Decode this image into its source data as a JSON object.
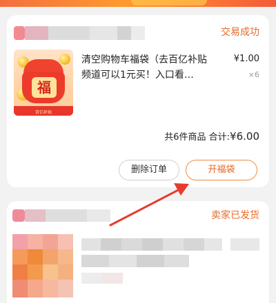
{
  "order1": {
    "status": "交易成功",
    "product_title": "清空购物车福袋（去百亿补贴频道可以1元买！入口看…",
    "product_image_text": "福",
    "product_image_caption": "百亿补贴",
    "price": "¥1.00",
    "quantity": "×6",
    "summary_prefix": "共6件商品 合计:",
    "summary_total": "¥6.00",
    "delete_button": "删除订单",
    "open_button": "开福袋"
  },
  "order2": {
    "status": "卖家已发货"
  },
  "colors": {
    "accent": "#e96a2a",
    "annotation_arrow": "#e63b2e"
  }
}
